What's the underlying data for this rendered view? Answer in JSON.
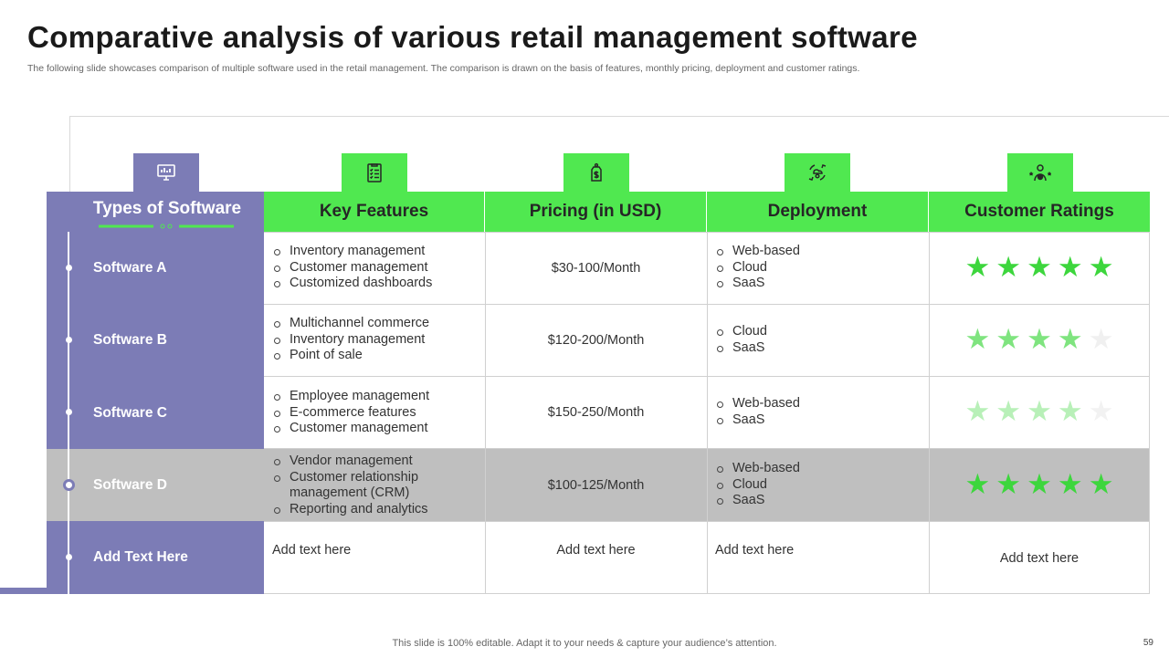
{
  "slide": {
    "title": "Comparative analysis of various retail management software",
    "subtitle": "The following slide showcases comparison of multiple software used in the retail management. The comparison is drawn on the basis of features, monthly pricing, deployment and customer ratings.",
    "footer": "This slide is 100% editable. Adapt it to your needs & capture your audience’s attention.",
    "page_number": "59"
  },
  "colors": {
    "accent_green": "#50e850",
    "purple": "#7c7cb6",
    "highlight_gray": "#bfbfbf",
    "star_full": "#3dd63d"
  },
  "icons": [
    "monitor-analytics-icon",
    "checklist-icon",
    "price-tag-dollar-icon",
    "cloud-deployment-icon",
    "customer-rating-icon"
  ],
  "table": {
    "first_header": "Types of Software",
    "headers": [
      "Key Features",
      "Pricing (in USD)",
      "Deployment",
      "Customer Ratings"
    ],
    "rows": [
      {
        "name": "Software A",
        "features": [
          "Inventory management",
          "Customer management",
          "Customized dashboards"
        ],
        "pricing": "$30-100/Month",
        "deployment": [
          "Web-based",
          "Cloud",
          "SaaS"
        ],
        "rating": 5
      },
      {
        "name": "Software B",
        "features": [
          "Multichannel commerce",
          "Inventory management",
          "Point of sale"
        ],
        "pricing": "$120-200/Month",
        "deployment": [
          "Cloud",
          "SaaS"
        ],
        "rating": 4
      },
      {
        "name": "Software C",
        "features": [
          "Employee management",
          "E-commerce features",
          "Customer management"
        ],
        "pricing": "$150-250/Month",
        "deployment": [
          "Web-based",
          "SaaS"
        ],
        "rating": 4
      },
      {
        "name": "Software D",
        "features": [
          "Vendor management",
          "Customer relationship management (CRM)",
          "Reporting and analytics"
        ],
        "pricing": "$100-125/Month",
        "deployment": [
          "Web-based",
          "Cloud",
          "SaaS"
        ],
        "rating": 5
      },
      {
        "name": "Add Text Here",
        "features_text": "Add text here",
        "pricing": "Add text here",
        "deployment_text": "Add text here",
        "rating_text": "Add text here"
      }
    ]
  }
}
